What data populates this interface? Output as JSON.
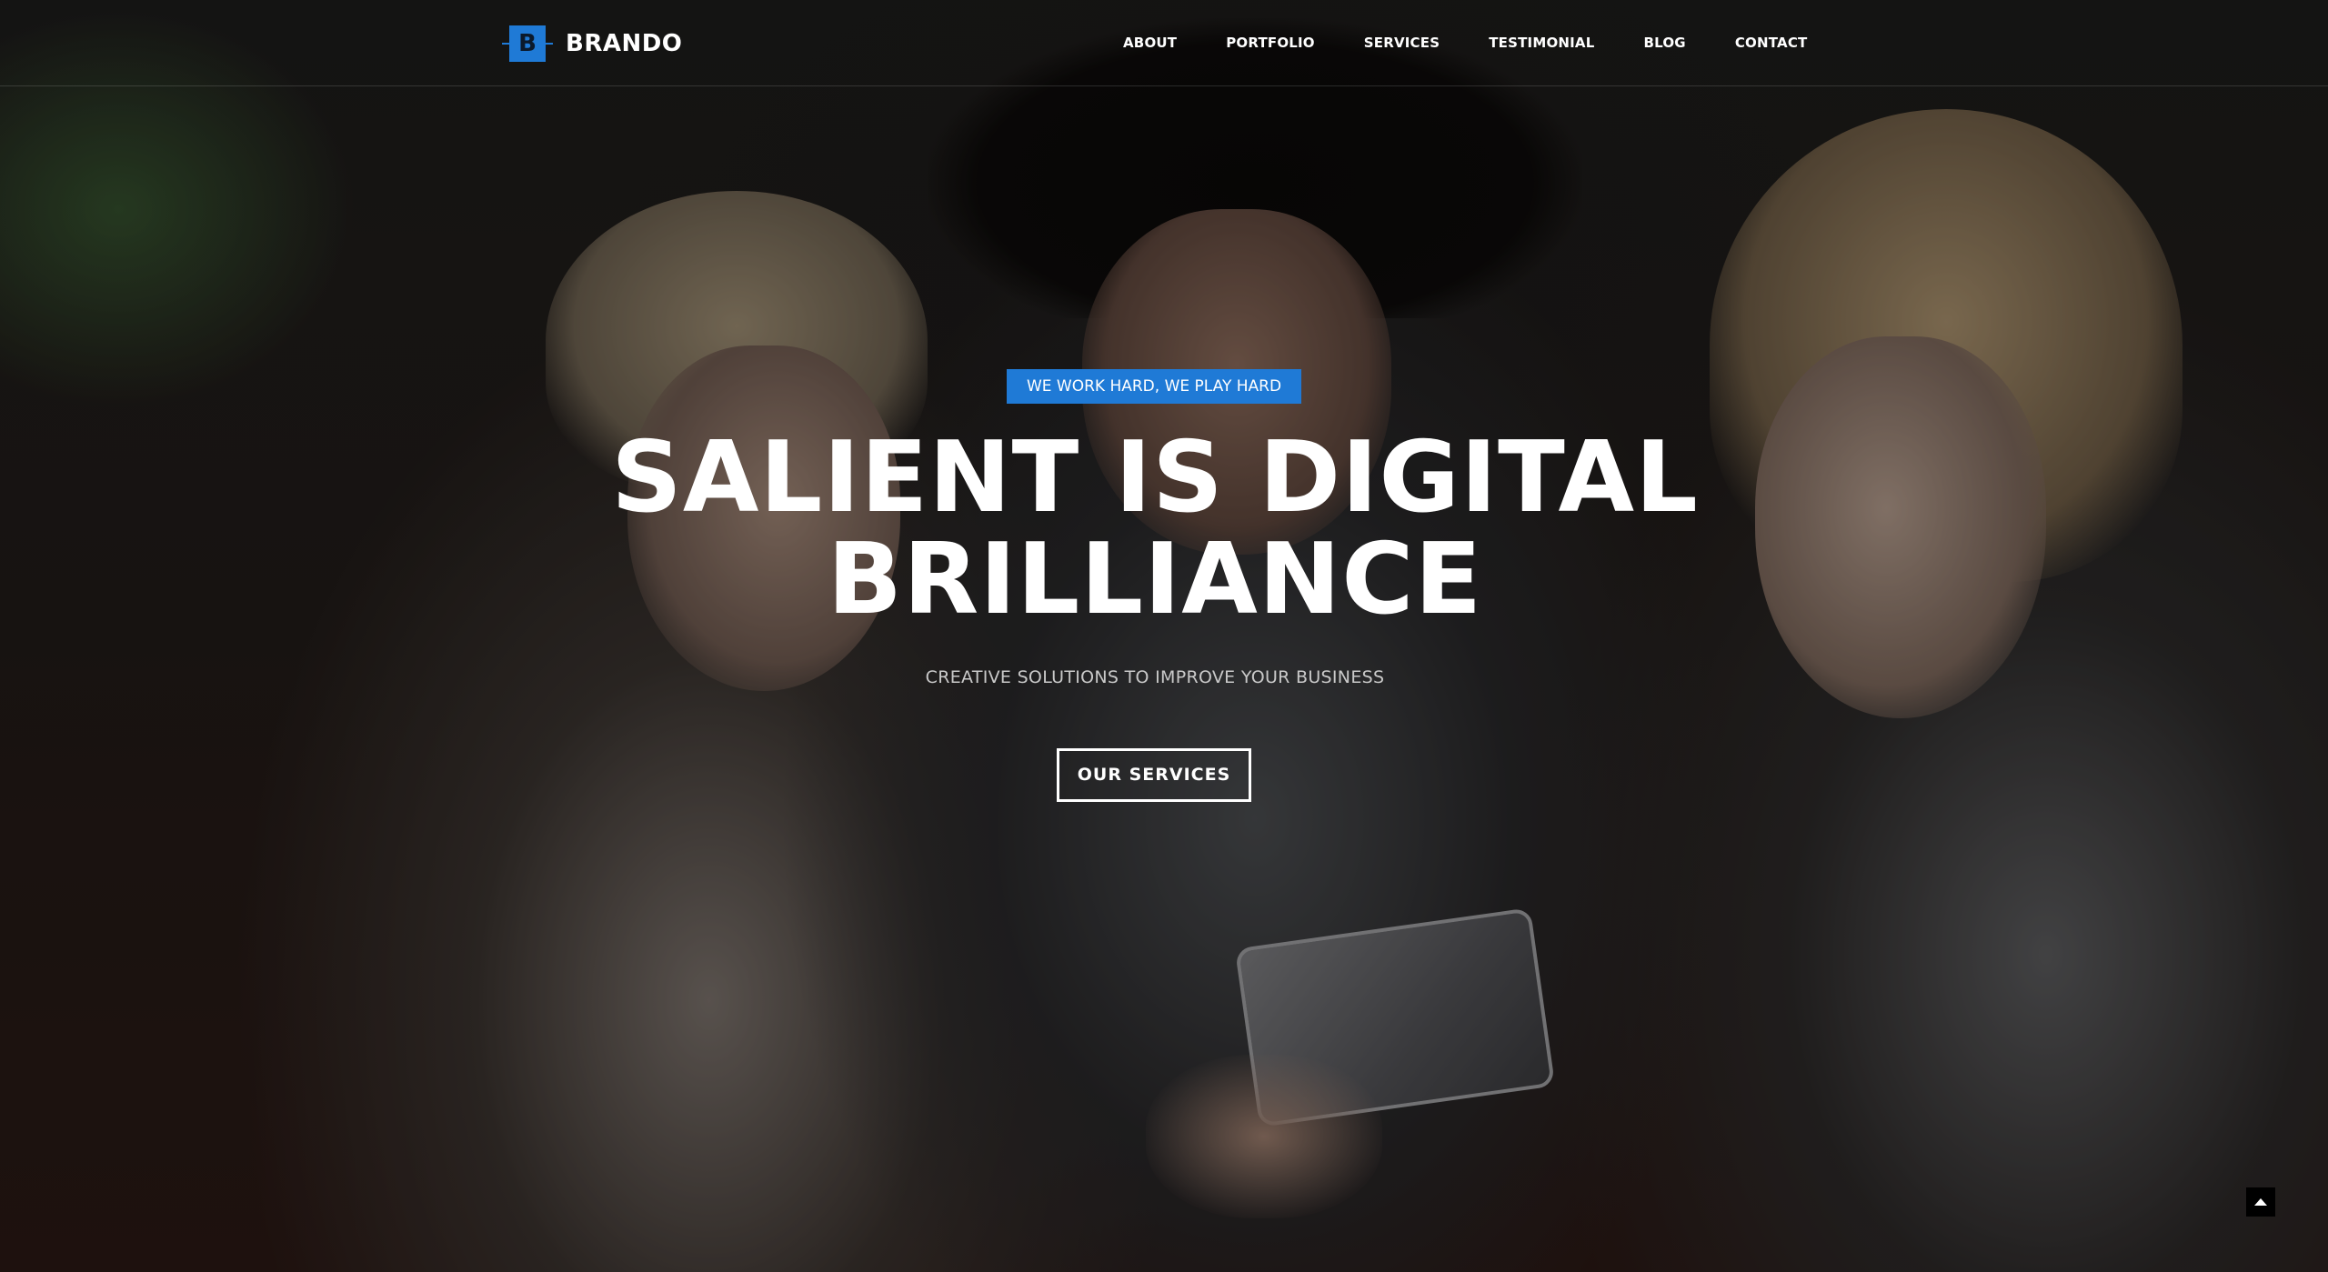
{
  "brand": {
    "logo_letter": "B",
    "name": "BRANDO",
    "accent_color": "#1f7ad6"
  },
  "nav": {
    "items": [
      {
        "label": "ABOUT"
      },
      {
        "label": "PORTFOLIO"
      },
      {
        "label": "SERVICES"
      },
      {
        "label": "TESTIMONIAL"
      },
      {
        "label": "BLOG"
      },
      {
        "label": "CONTACT"
      }
    ]
  },
  "hero": {
    "tagline": "WE WORK HARD, WE PLAY HARD",
    "headline_line1": "SALIENT IS DIGITAL",
    "headline_line2": "BRILLIANCE",
    "subtitle": "CREATIVE SOLUTIONS TO IMPROVE YOUR BUSINESS",
    "cta_label": "OUR SERVICES",
    "background_image": "three people looking at a tablet"
  },
  "scroll_top": {
    "icon": "chevron-up-icon"
  }
}
